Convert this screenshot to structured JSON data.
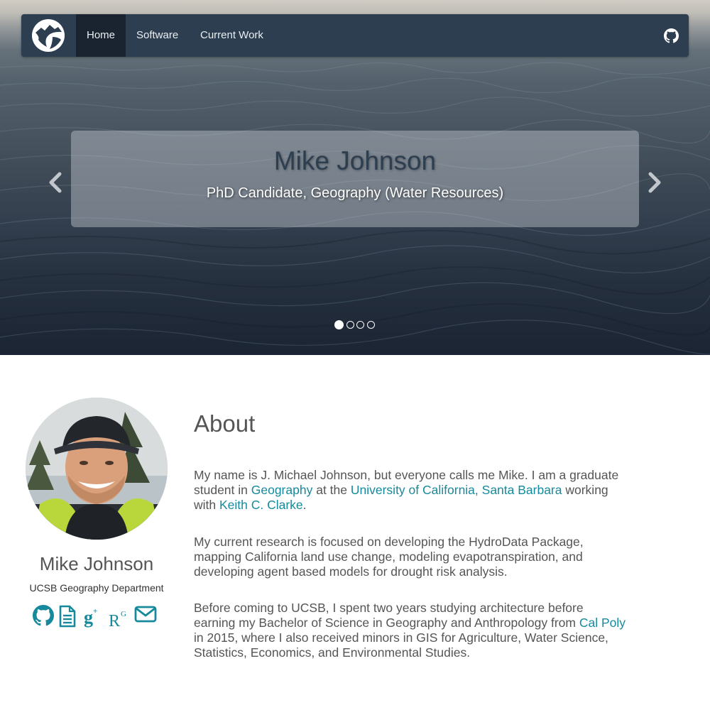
{
  "nav": {
    "items": [
      {
        "label": "Home",
        "active": true
      },
      {
        "label": "Software",
        "active": false
      },
      {
        "label": "Current Work",
        "active": false
      }
    ],
    "brand_icon": "river-logo-icon",
    "right_icon": "github-icon",
    "bar_color": "#2d3e50",
    "active_color": "#1a2430"
  },
  "carousel": {
    "title": "Mike Johnson",
    "subtitle": "PhD Candidate, Geography (Water Resources)",
    "indicator_count": 4,
    "active_index": 0,
    "prev_icon": "chevron-left-icon",
    "next_icon": "chevron-right-icon"
  },
  "profile": {
    "name": "Mike Johnson",
    "department": "UCSB Geography Department",
    "social_icons": [
      "github-icon",
      "cv-document-icon",
      "google-scholar-icon",
      "researchgate-icon",
      "envelope-icon"
    ],
    "icon_color": "#168a9c"
  },
  "about": {
    "heading": "About",
    "p1": {
      "t1": "My name is J. Michael Johnson, but everyone calls me Mike. I am a graduate student in ",
      "l1": "Geography",
      "t2": " at the ",
      "l2": "University of California, Santa Barbara",
      "t3": " working with ",
      "l3": "Keith C. Clarke",
      "t4": "."
    },
    "p2": "My current research is focused on developing the HydroData Package, mapping California land use change, modeling evapotranspiration, and developing agent based models for drought risk analysis.",
    "p3": {
      "t1": "Before coming to UCSB, I spent two years studying architecture before earning my Bachelor of Science in Geography and Anthropology from ",
      "l1": "Cal Poly",
      "t2": " in 2015, where I also received minors in GIS for Agriculture, Water Science, Statistics, Economics, and Environmental Studies."
    },
    "link_color": "#168a9c"
  }
}
